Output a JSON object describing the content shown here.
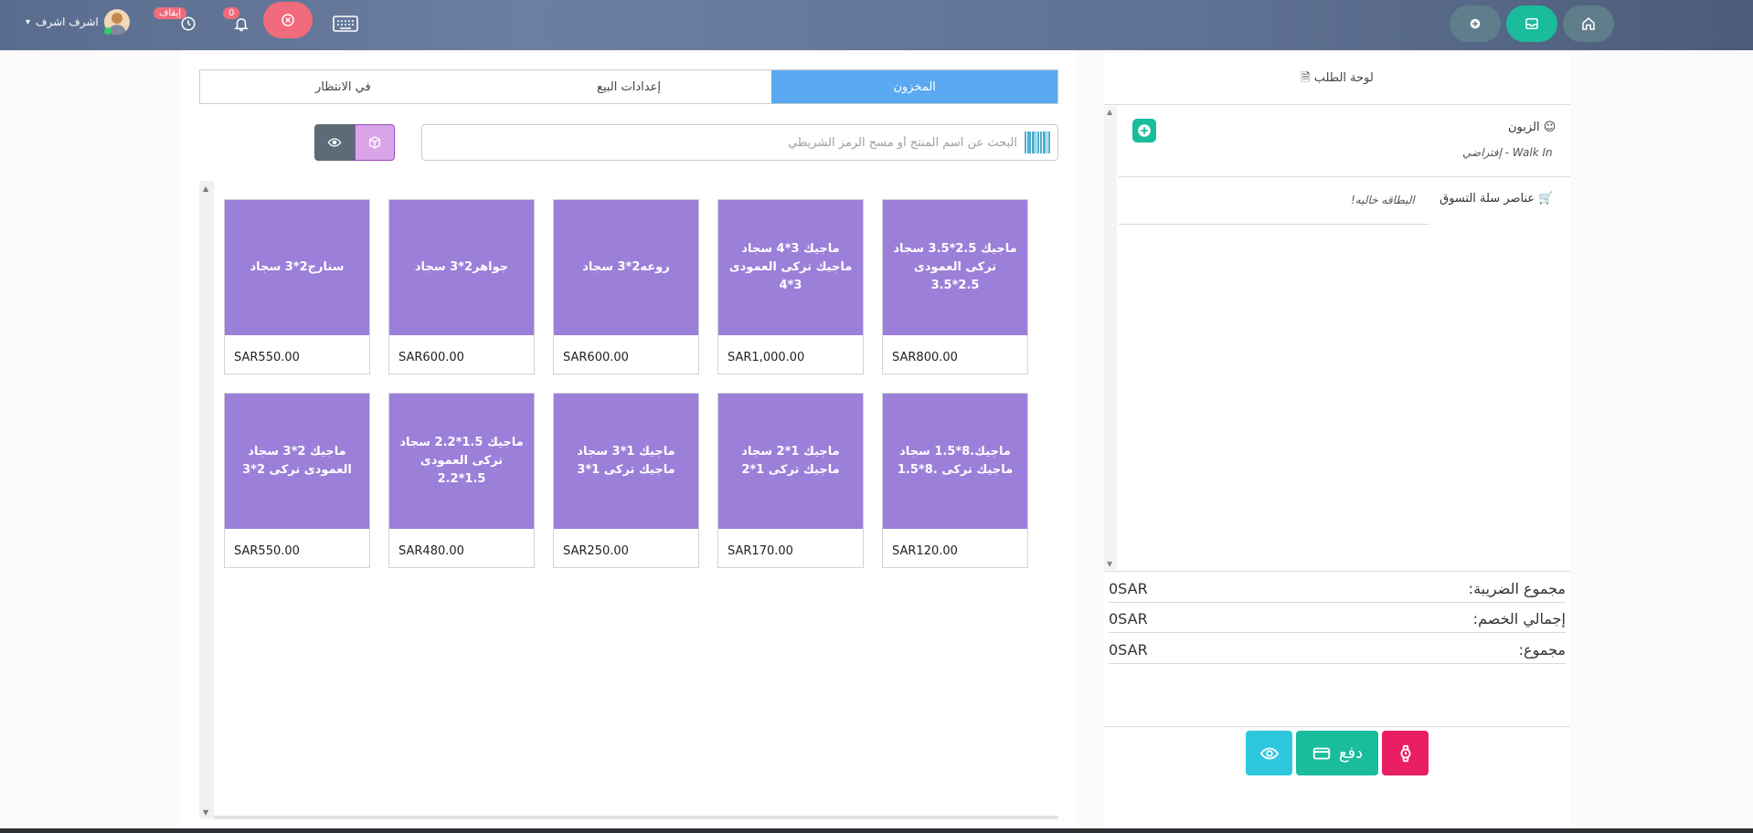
{
  "header": {
    "user_name": "اشرف اشرف",
    "notifications_count": "0",
    "clock_badge": "إيقاف",
    "icons": [
      "home-icon",
      "mail-icon",
      "plus-circle-icon",
      "keyboard-icon",
      "close-circle-icon",
      "bell-icon",
      "clock-icon"
    ],
    "colors": {
      "home": "#607d8b",
      "mail": "#1abc9c",
      "plus": "#607d8b",
      "close": "#f06b7c"
    }
  },
  "tabs": [
    {
      "label": "المخزون",
      "active": true
    },
    {
      "label": "إعدادات البيع",
      "active": false
    },
    {
      "label": "في الانتظار",
      "active": false
    }
  ],
  "search": {
    "placeholder": "البحث عن اسم المنتج أو مسح الرمز الشريطي",
    "value": ""
  },
  "products": [
    {
      "name": "ماجيك 2.5*3.5 سجاد تركى العمودى 2.5*3.5",
      "price": "SAR800.00"
    },
    {
      "name": "ماجيك 3*4 سجاد ماجيك تركى العمودى 3*4",
      "price": "SAR1,000.00"
    },
    {
      "name": "روعه2*3 سجاد",
      "price": "SAR600.00"
    },
    {
      "name": "جواهر2*3 سجاد",
      "price": "SAR600.00"
    },
    {
      "name": "سنارج2*3 سجاد",
      "price": "SAR550.00"
    },
    {
      "name": "ماجيك.8*1.5 سجاد ماجيك تركى .8*1.5",
      "price": "SAR120.00"
    },
    {
      "name": "ماجيك 1*2 سجاد ماجيك تركى 1*2",
      "price": "SAR170.00"
    },
    {
      "name": "ماجيك 1*3 سجاد ماجيك تركى 1*3",
      "price": "SAR250.00"
    },
    {
      "name": "ماجيك 1.5*2.2 سجاد تركى العمودى 1.5*2.2",
      "price": "SAR480.00"
    },
    {
      "name": "ماجيك 2*3 سجاد العمودى تركى 2*3",
      "price": "SAR550.00"
    }
  ],
  "order": {
    "title": "لوحة الطلب",
    "customer_label": "الزبون",
    "customer_value": "إفتراضي - Walk In",
    "cart_label": "عناصر سلة التسوق",
    "cart_empty": "البطاقه خاليه!",
    "tax_label": "مجموع الضريبة:",
    "tax_value": "0SAR",
    "discount_label": "إجمالي الخصم:",
    "discount_value": "0SAR",
    "total_label": "مجموع:",
    "total_value": "0SAR",
    "pay_label": "دفع"
  },
  "tile_color": "#9b7fd9"
}
